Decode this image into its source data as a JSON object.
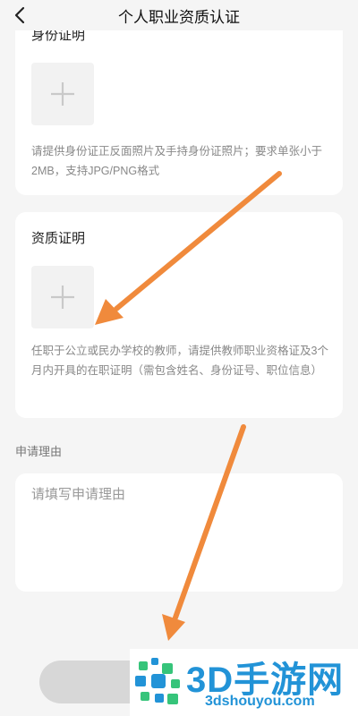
{
  "header": {
    "title": "个人职业资质认证",
    "back_icon": "chevron-left-icon"
  },
  "identity_section": {
    "label": "身份证明",
    "upload_icon": "plus-icon",
    "hint": "请提供身份证正反面照片及手持身份证照片；要求单张小于2MB，支持JPG/PNG格式"
  },
  "qualification_section": {
    "label": "资质证明",
    "upload_icon": "plus-icon",
    "hint": "任职于公立或民办学校的教师，请提供教师职业资格证及3个月内开具的在职证明（需包含姓名、身份证号、职位信息）"
  },
  "reason_section": {
    "label": "申请理由",
    "placeholder": "请填写申请理由",
    "value": ""
  },
  "watermark": {
    "text": "3D手游网",
    "url": "3dshouyou.com"
  },
  "colors": {
    "annotation_arrow": "#f08a3c",
    "watermark_blue": "#2293d7",
    "watermark_green": "#36c47a",
    "submit_button_disabled": "#d7d7d7"
  }
}
